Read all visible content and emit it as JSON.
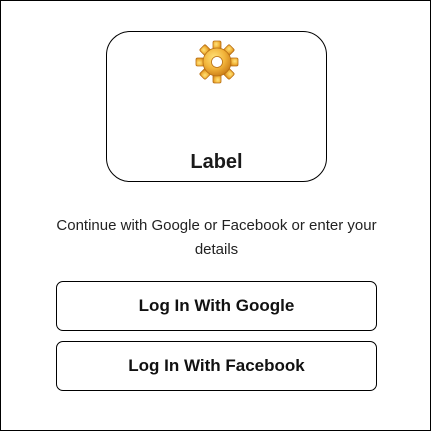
{
  "logo": {
    "icon": "gear-icon",
    "label": "Label"
  },
  "subtitle": "Continue with Google or Facebook or enter your details",
  "buttons": {
    "google": "Log In With Google",
    "facebook": "Log In With Facebook"
  },
  "colors": {
    "border": "#000000",
    "background": "#ffffff",
    "gear_fill": "#f2b43a",
    "gear_shadow": "#d98a1c"
  }
}
